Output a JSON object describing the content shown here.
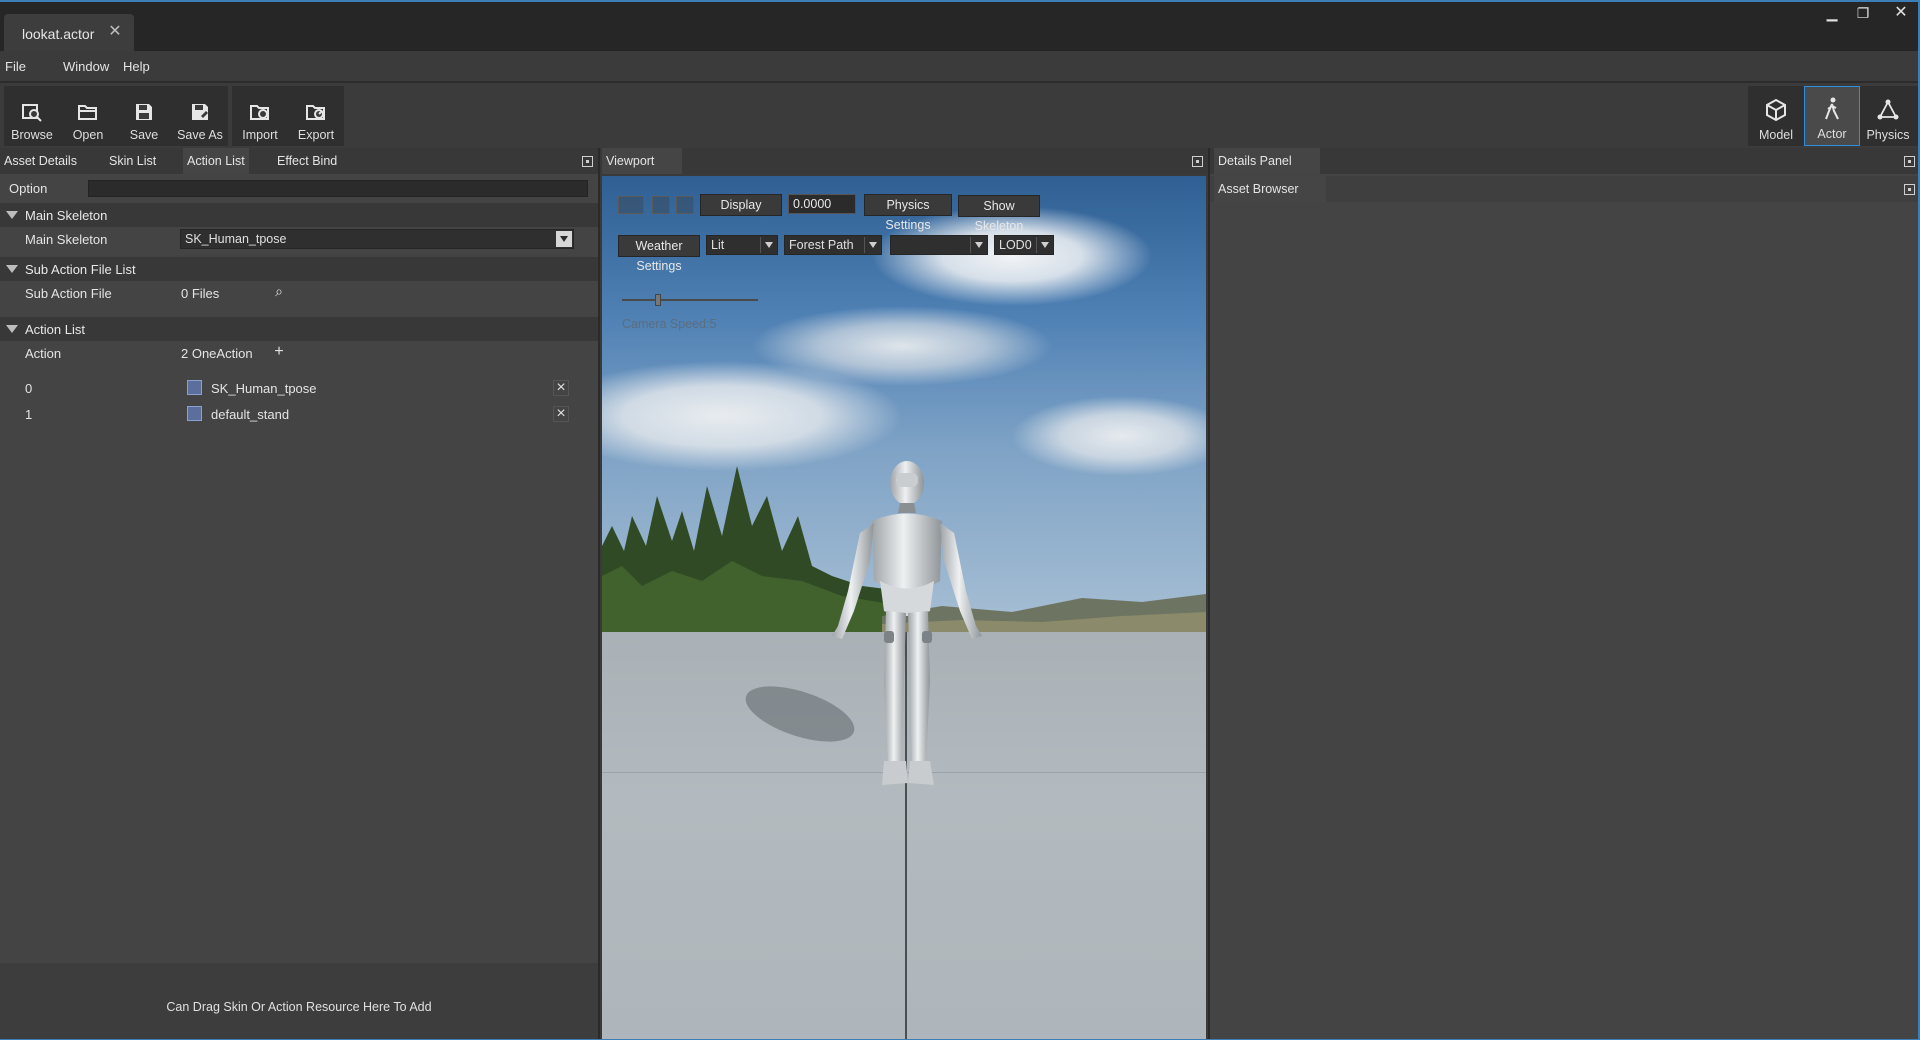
{
  "window": {
    "document_tab": "lookat.actor",
    "controls": [
      "minimize-icon",
      "restore-icon",
      "close-icon"
    ]
  },
  "menu": [
    "File",
    "Window",
    "Help"
  ],
  "toolbar": {
    "left_group_1": [
      {
        "label": "Browse",
        "icon": "browse-icon"
      },
      {
        "label": "Open",
        "icon": "folder-open-icon"
      },
      {
        "label": "Save",
        "icon": "save-icon"
      },
      {
        "label": "Save As",
        "icon": "save-as-icon"
      }
    ],
    "left_group_2": [
      {
        "label": "Import",
        "icon": "import-icon"
      },
      {
        "label": "Export",
        "icon": "export-icon"
      }
    ],
    "mode_group": [
      {
        "label": "Model",
        "icon": "cube-icon"
      },
      {
        "label": "Actor",
        "icon": "walking-person-icon",
        "active": true
      },
      {
        "label": "Physics",
        "icon": "physics-nodes-icon"
      }
    ]
  },
  "left_panel": {
    "tabs": [
      "Asset Details",
      "Skin List",
      "Action List",
      "Effect Bind"
    ],
    "active_tab": "Action List",
    "option_label": "Option",
    "sections": {
      "main_skeleton": {
        "title": "Main Skeleton",
        "prop_label": "Main Skeleton",
        "value": "SK_Human_tpose"
      },
      "sub_action_file_list": {
        "title": "Sub Action File List",
        "prop_label": "Sub Action File",
        "value": "0 Files"
      },
      "action_list": {
        "title": "Action List",
        "prop_label": "Action",
        "value": "2 OneAction",
        "items": [
          {
            "index": "0",
            "name": "SK_Human_tpose"
          },
          {
            "index": "1",
            "name": "default_stand"
          }
        ]
      }
    },
    "drop_hint": "Can Drag Skin Or Action Resource Here To Add"
  },
  "viewport": {
    "tab": "Viewport",
    "display_button": "Display",
    "time_value": "0.0000",
    "physics_button": "Physics Settings",
    "skeleton_button": "Show Skeleton",
    "weather_button": "Weather Settings",
    "lighting_select": "Lit",
    "scene_select": "Forest Path",
    "extra_select": "",
    "lod_select": "LOD0",
    "camera_speed": "Camera Speed:5",
    "camera_speed_level": 0.25
  },
  "right_panel": {
    "tab_top": "Details Panel",
    "tab_bottom": "Asset Browser"
  },
  "colors": {
    "accent": "#2f8ee0",
    "panel_bg": "#444444",
    "header_bg": "#383838"
  }
}
